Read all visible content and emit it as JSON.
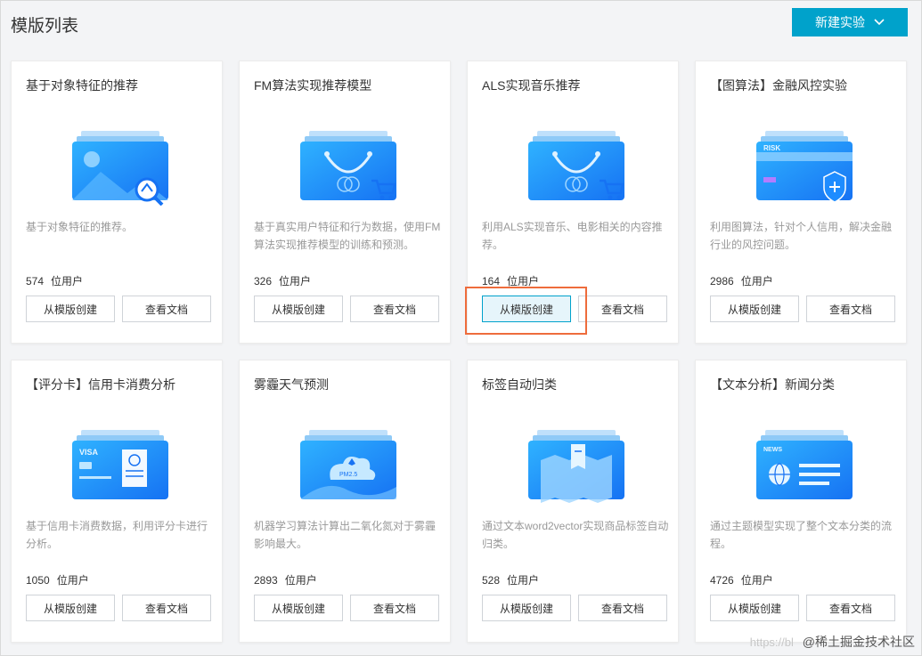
{
  "header": {
    "title": "模版列表",
    "new_button_label": "新建实验"
  },
  "cards": [
    {
      "title": "基于对象特征的推荐",
      "desc": "基于对象特征的推荐。",
      "users": "574",
      "unit": "位用户",
      "create_label": "从模版创建",
      "docs_label": "查看文档",
      "illustration": "image-search-icon"
    },
    {
      "title": "FM算法实现推荐模型",
      "desc": "基于真实用户特征和行为数据，使用FM算法实现推荐模型的训练和预测。",
      "users": "326",
      "unit": "位用户",
      "create_label": "从模版创建",
      "docs_label": "查看文档",
      "illustration": "shopping-bag-icon"
    },
    {
      "title": "ALS实现音乐推荐",
      "desc": "利用ALS实现音乐、电影相关的内容推荐。",
      "users": "164",
      "unit": "位用户",
      "create_label": "从模版创建",
      "docs_label": "查看文档",
      "illustration": "shopping-bag-icon"
    },
    {
      "title": "【图算法】金融风控实验",
      "desc": "利用图算法，针对个人信用，解决金融行业的风控问题。",
      "users": "2986",
      "unit": "位用户",
      "create_label": "从模版创建",
      "docs_label": "查看文档",
      "illustration": "risk-card-shield-icon",
      "card_text": "RISK"
    },
    {
      "title": "【评分卡】信用卡消费分析",
      "desc": "基于信用卡消费数据，利用评分卡进行分析。",
      "users": "1050",
      "unit": "位用户",
      "create_label": "从模版创建",
      "docs_label": "查看文档",
      "illustration": "credit-card-receipt-icon",
      "card_text": "VISA"
    },
    {
      "title": "雾霾天气预测",
      "desc": "机器学习算法计算出二氧化氮对于雾霾影响最大。",
      "users": "2893",
      "unit": "位用户",
      "create_label": "从模版创建",
      "docs_label": "查看文档",
      "illustration": "cloud-pm25-icon",
      "card_text": "PM2.5"
    },
    {
      "title": "标签自动归类",
      "desc": "通过文本word2vector实现商品标签自动归类。",
      "users": "528",
      "unit": "位用户",
      "create_label": "从模版创建",
      "docs_label": "查看文档",
      "illustration": "tag-map-icon"
    },
    {
      "title": "【文本分析】新闻分类",
      "desc": "通过主题模型实现了整个文本分类的流程。",
      "users": "4726",
      "unit": "位用户",
      "create_label": "从模版创建",
      "docs_label": "查看文档",
      "illustration": "news-globe-icon",
      "card_text": "NEWS"
    }
  ],
  "watermark": {
    "faint": "https://bl",
    "text": "@稀土掘金技术社区"
  },
  "colors": {
    "accent": "#00a2cb",
    "highlight": "#ee6c3c",
    "illustration_blue": "#1e90ff"
  }
}
